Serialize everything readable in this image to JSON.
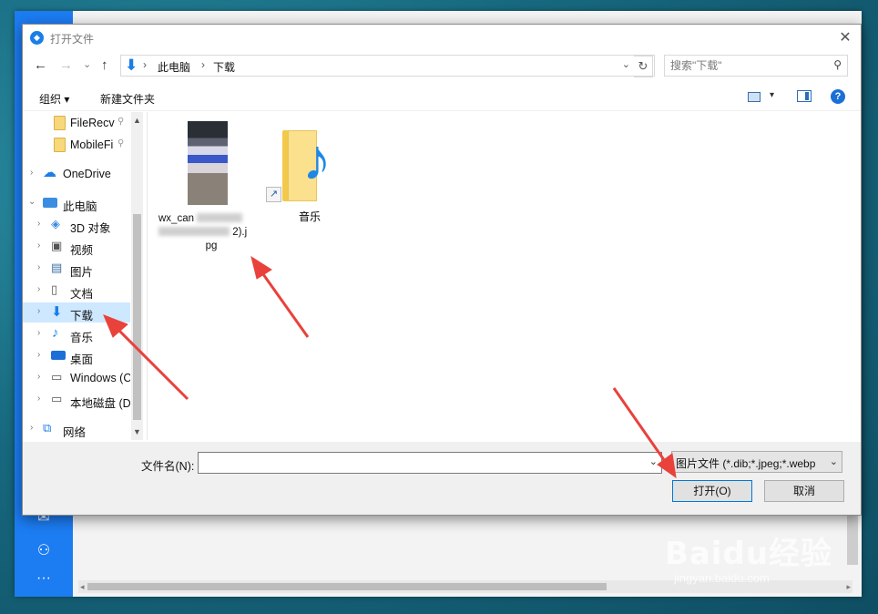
{
  "window": {
    "title": "打开文件",
    "close_glyph": "✕"
  },
  "nav": {
    "back_glyph": "←",
    "forward_glyph": "→",
    "recent_glyph": "⌄",
    "up_glyph": "↑",
    "crumbs": [
      "此电脑",
      "下载"
    ],
    "crumb_sep": "›",
    "dropdown_glyph": "⌄",
    "refresh_glyph": "↻"
  },
  "search": {
    "placeholder": "搜索\"下载\"",
    "icon": "⚲"
  },
  "toolbar": {
    "organize": "组织 ▾",
    "new_folder": "新建文件夹",
    "help_glyph": "?"
  },
  "sidebar": {
    "items": [
      {
        "label": "FileRecv",
        "icon": "folder-icon",
        "pinned": true
      },
      {
        "label": "MobileFi",
        "icon": "folder-icon",
        "pinned": true
      },
      {
        "label": "OneDrive",
        "icon": "cloud-icon"
      },
      {
        "label": "此电脑",
        "icon": "computer-icon",
        "expanded": true
      },
      {
        "label": "3D 对象",
        "icon": "cube-icon"
      },
      {
        "label": "视频",
        "icon": "video-icon"
      },
      {
        "label": "图片",
        "icon": "pictures-icon"
      },
      {
        "label": "文档",
        "icon": "document-icon"
      },
      {
        "label": "下载",
        "icon": "download-icon",
        "selected": true
      },
      {
        "label": "音乐",
        "icon": "music-icon"
      },
      {
        "label": "桌面",
        "icon": "desktop-icon"
      },
      {
        "label": "Windows (C",
        "icon": "drive-icon"
      },
      {
        "label": "本地磁盘 (D",
        "icon": "drive-icon"
      },
      {
        "label": "网络",
        "icon": "network-icon"
      }
    ],
    "pin_glyph": "📌",
    "chevron_right": "›",
    "chevron_down": "⌄"
  },
  "files": [
    {
      "name_line1": "wx_can",
      "name_line2": "2).j",
      "name_line3": "pg",
      "type": "image"
    },
    {
      "name": "音乐",
      "type": "folder-shortcut"
    }
  ],
  "bottom": {
    "filename_label": "文件名(N):",
    "filename_value": "",
    "filetype": "图片文件 (*.dib;*.jpeg;*.webp",
    "open_label": "打开(O)",
    "cancel_label": "取消"
  },
  "background": {
    "watermark": "Baidu经验",
    "watermark_sub": "jingyan.baidu.com"
  },
  "colors": {
    "accent": "#1b7ee6",
    "arrow": "#e8423b",
    "selected": "#cde8ff"
  }
}
